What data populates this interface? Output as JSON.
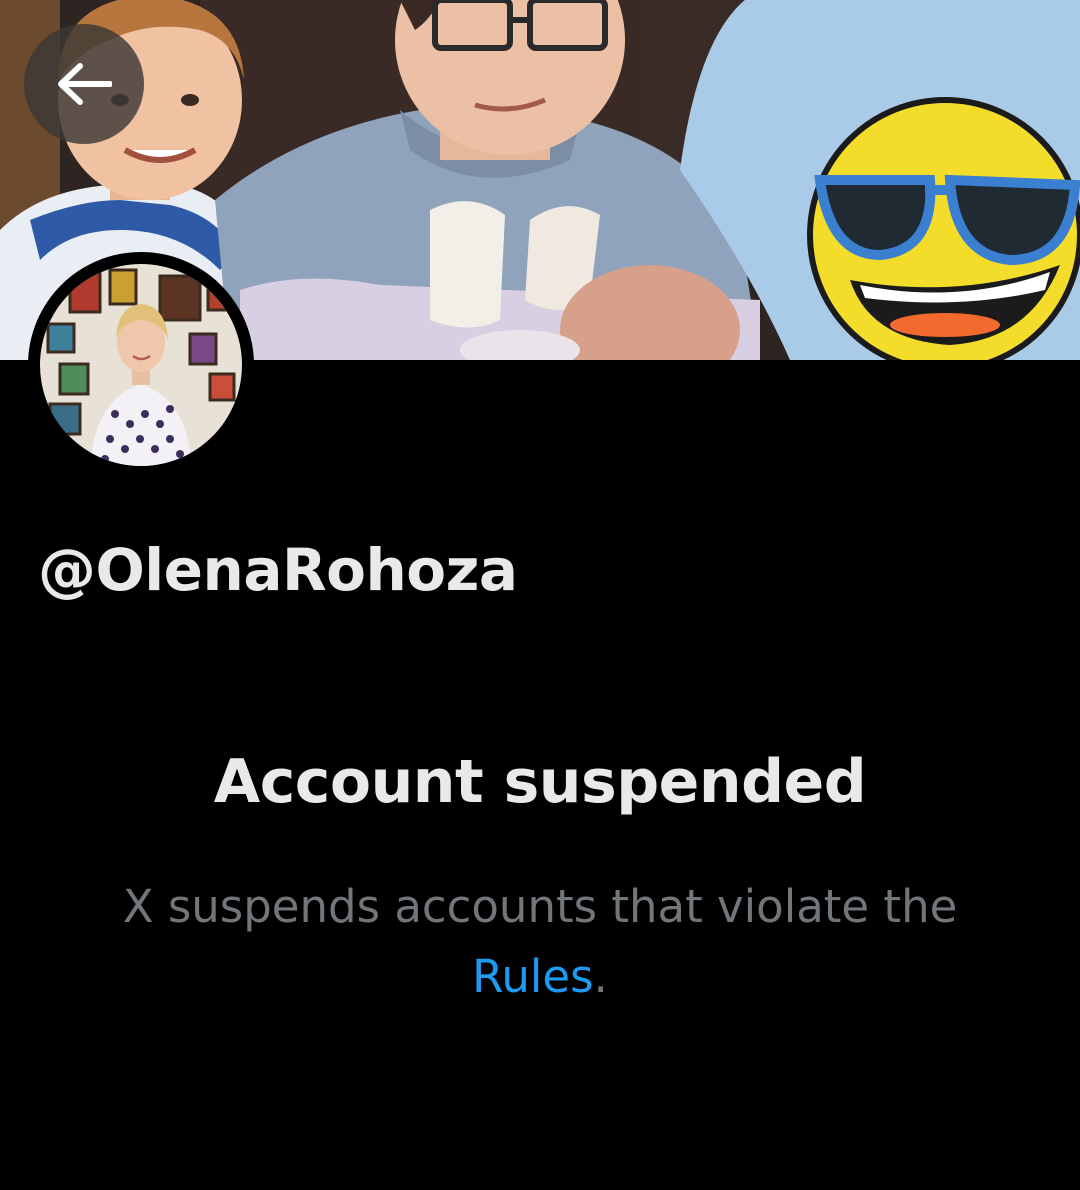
{
  "header": {
    "back_button_icon": "arrow-left-icon",
    "banner_image": "profile-banner-photo",
    "avatar_image": "profile-avatar-photo"
  },
  "profile": {
    "handle": "@OlenaRohoza"
  },
  "suspension": {
    "title": "Account suspended",
    "body_prefix": "X suspends accounts that violate the ",
    "rules_link": "Rules",
    "body_suffix": "."
  },
  "colors": {
    "background": "#000000",
    "primary_text": "#e7e9ea",
    "secondary_text": "#71767b",
    "link": "#1d9bf0"
  }
}
